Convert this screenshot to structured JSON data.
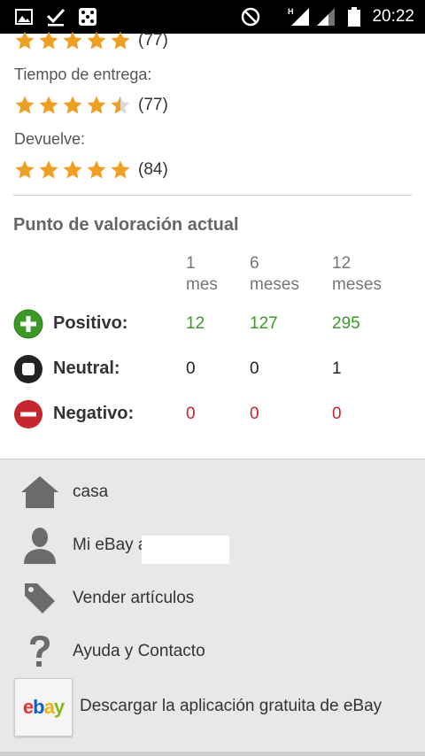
{
  "status_bar": {
    "time": "20:22",
    "icons": [
      "image-icon",
      "checkmark-icon",
      "dice-icon",
      "do-not-disturb-icon",
      "signal-h-icon",
      "signal-icon",
      "battery-icon"
    ]
  },
  "ratings": [
    {
      "label": "",
      "stars": 5,
      "count": "(77)"
    },
    {
      "label": "Tiempo de entrega:",
      "stars": 4.5,
      "count": "(77)"
    },
    {
      "label": "Devuelve:",
      "stars": 5,
      "count": "(84)"
    }
  ],
  "feedback": {
    "title": "Punto de valoración actual",
    "columns": [
      {
        "line1": "1",
        "line2": "mes"
      },
      {
        "line1": "6",
        "line2": "meses"
      },
      {
        "line1": "12",
        "line2": "meses"
      }
    ],
    "rows": [
      {
        "label": "Positivo:",
        "icon": "plus-circle-icon",
        "values": [
          "12",
          "127",
          "295"
        ],
        "color": "#3a9a24"
      },
      {
        "label": "Neutral:",
        "icon": "square-circle-icon",
        "values": [
          "0",
          "0",
          "1"
        ],
        "color": "#222222"
      },
      {
        "label": "Negativo:",
        "icon": "minus-circle-icon",
        "values": [
          "0",
          "0",
          "0"
        ],
        "color": "#c8242e"
      }
    ]
  },
  "menu": {
    "items": [
      {
        "label": "casa",
        "icon": "home-icon"
      },
      {
        "label": "Mi eBay a",
        "icon": "user-icon"
      },
      {
        "label": "Vender artículos",
        "icon": "tag-icon"
      },
      {
        "label": "Ayuda y Contacto",
        "icon": "help-icon"
      }
    ],
    "app_download": {
      "label": "Descargar la aplicación gratuita de eBay",
      "logo_text": "ebay"
    }
  },
  "colors": {
    "star": "#f0a020",
    "positive": "#3a9a24",
    "neutral": "#222222",
    "negative": "#c8242e",
    "menu_bg": "#e8e8e8"
  }
}
